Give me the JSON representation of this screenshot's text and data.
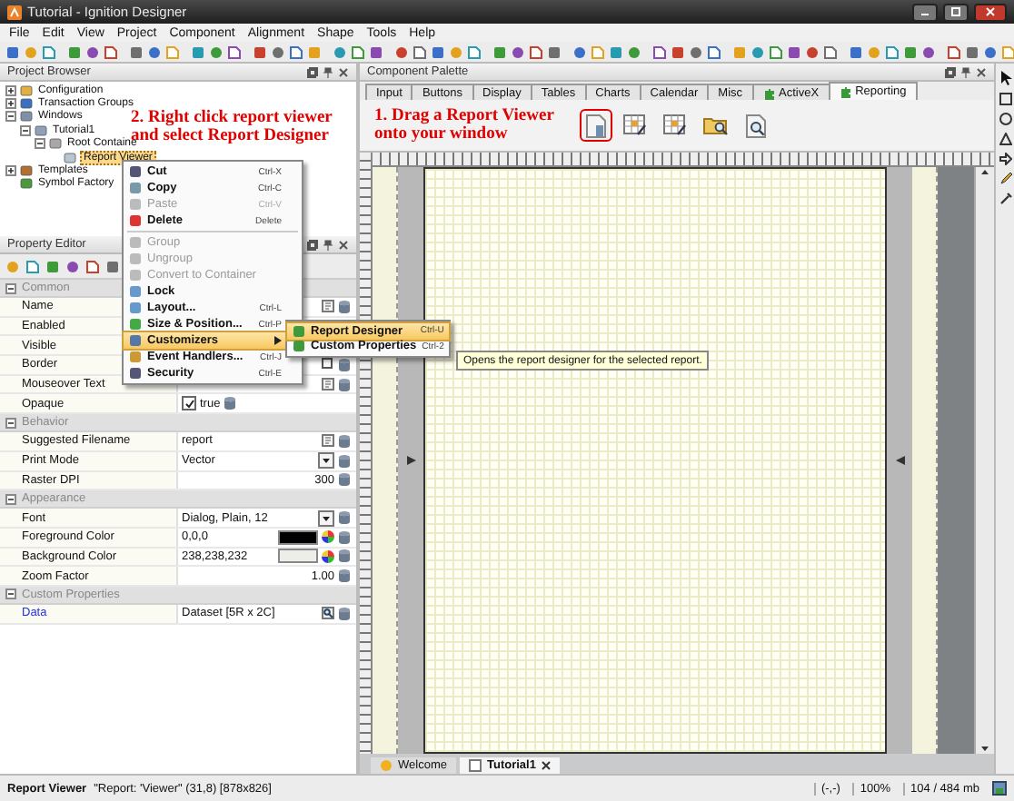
{
  "window": {
    "title": "Tutorial - Ignition Designer"
  },
  "menu": [
    "File",
    "Edit",
    "View",
    "Project",
    "Component",
    "Alignment",
    "Shape",
    "Tools",
    "Help"
  ],
  "project_browser": {
    "title": "Project Browser",
    "tree": [
      {
        "label": "Configuration",
        "kind": "config",
        "expanded": false,
        "selected": false
      },
      {
        "label": "Transaction Groups",
        "kind": "groups",
        "expanded": false,
        "selected": false
      },
      {
        "label": "Windows",
        "kind": "windows",
        "expanded": true,
        "selected": false,
        "children": [
          {
            "label": "Tutorial1",
            "kind": "window",
            "expanded": true,
            "selected": false,
            "children": [
              {
                "label": "Root Containe",
                "kind": "container",
                "expanded": true,
                "selected": false,
                "children": [
                  {
                    "label": "Report Viewer",
                    "kind": "component",
                    "selected": true
                  }
                ]
              }
            ]
          }
        ]
      },
      {
        "label": "Templates",
        "kind": "templates",
        "expanded": false,
        "selected": false
      },
      {
        "label": "Symbol Factory",
        "kind": "symbols",
        "selected": false
      }
    ]
  },
  "callouts": [
    {
      "lines": [
        "2. Right click report viewer",
        "and select Report Designer"
      ]
    },
    {
      "lines": [
        "1. Drag a Report Viewer",
        "onto your window"
      ]
    }
  ],
  "context_menu": {
    "items": [
      {
        "kind": "item",
        "label": "Cut",
        "shortcut": "Ctrl-X",
        "disabled": false,
        "selected": false,
        "submenu": false
      },
      {
        "kind": "item",
        "label": "Copy",
        "shortcut": "Ctrl-C",
        "disabled": false,
        "selected": false,
        "submenu": false
      },
      {
        "kind": "item",
        "label": "Paste",
        "shortcut": "Ctrl-V",
        "disabled": true,
        "selected": false,
        "submenu": false
      },
      {
        "kind": "item",
        "label": "Delete",
        "shortcut": "Delete",
        "disabled": false,
        "selected": false,
        "submenu": false
      },
      {
        "kind": "separator"
      },
      {
        "kind": "item",
        "label": "Group",
        "disabled": true,
        "selected": false,
        "submenu": false
      },
      {
        "kind": "item",
        "label": "Ungroup",
        "disabled": true,
        "selected": false,
        "submenu": false
      },
      {
        "kind": "item",
        "label": "Convert to Container",
        "disabled": true,
        "selected": false,
        "submenu": false
      },
      {
        "kind": "item",
        "label": "Lock",
        "disabled": false,
        "selected": false,
        "submenu": false
      },
      {
        "kind": "item",
        "label": "Layout...",
        "shortcut": "Ctrl-L",
        "disabled": false,
        "selected": false,
        "submenu": false
      },
      {
        "kind": "item",
        "label": "Size & Position...",
        "shortcut": "Ctrl-P",
        "disabled": false,
        "selected": false,
        "submenu": false
      },
      {
        "kind": "item",
        "label": "Customizers",
        "disabled": false,
        "selected": true,
        "submenu": true
      },
      {
        "kind": "item",
        "label": "Event Handlers...",
        "shortcut": "Ctrl-J",
        "disabled": false,
        "selected": false,
        "submenu": false
      },
      {
        "kind": "item",
        "label": "Security",
        "shortcut": "Ctrl-E",
        "disabled": false,
        "selected": false,
        "submenu": false
      }
    ]
  },
  "submenu": {
    "items": [
      {
        "label": "Report Designer",
        "shortcut": "Ctrl-U",
        "selected": true
      },
      {
        "label": "Custom Properties",
        "shortcut": "Ctrl-2",
        "selected": false
      }
    ]
  },
  "tooltip": {
    "text": "Opens the report designer for the selected report."
  },
  "property_editor": {
    "title": "Property Editor",
    "groups": [
      {
        "name": "Common",
        "expanded": true,
        "properties": [
          {
            "name": "Name",
            "kind": "text"
          },
          {
            "name": "Enabled",
            "kind": "plain"
          },
          {
            "name": "Visible",
            "kind": "plain"
          },
          {
            "name": "Border",
            "kind": "border"
          },
          {
            "name": "Mouseover Text",
            "kind": "text"
          },
          {
            "name": "Opaque",
            "kind": "checkbox",
            "checked": true,
            "value": "true"
          }
        ]
      },
      {
        "name": "Behavior",
        "expanded": true,
        "properties": [
          {
            "name": "Suggested Filename",
            "kind": "text",
            "value": "report"
          },
          {
            "name": "Print Mode",
            "kind": "dropdown",
            "value": "Vector"
          },
          {
            "name": "Raster DPI",
            "kind": "number",
            "value": "300"
          }
        ]
      },
      {
        "name": "Appearance",
        "expanded": true,
        "properties": [
          {
            "name": "Font",
            "kind": "dropdown",
            "value": "Dialog, Plain, 12"
          },
          {
            "name": "Foreground Color",
            "kind": "color",
            "value": "0,0,0"
          },
          {
            "name": "Background Color",
            "kind": "color",
            "value": "238,238,232"
          },
          {
            "name": "Zoom Factor",
            "kind": "number",
            "value": "1.00"
          }
        ]
      },
      {
        "name": "Custom Properties",
        "expanded": true,
        "properties": [
          {
            "name": "Data",
            "kind": "dataset",
            "value": "Dataset [5R x 2C]"
          }
        ]
      }
    ]
  },
  "component_palette": {
    "title": "Component Palette",
    "tabs": [
      {
        "label": "Input",
        "kind": "builtin",
        "selected": false
      },
      {
        "label": "Buttons",
        "kind": "builtin",
        "selected": false
      },
      {
        "label": "Display",
        "kind": "builtin",
        "selected": false
      },
      {
        "label": "Tables",
        "kind": "builtin",
        "selected": false
      },
      {
        "label": "Charts",
        "kind": "builtin",
        "selected": false
      },
      {
        "label": "Calendar",
        "kind": "builtin",
        "selected": false
      },
      {
        "label": "Misc",
        "kind": "builtin",
        "selected": false
      },
      {
        "label": "ActiveX",
        "kind": "module",
        "selected": false
      },
      {
        "label": "Reporting",
        "kind": "module",
        "selected": true
      }
    ],
    "items": [
      {
        "kind": "viewer",
        "highlighted": true
      },
      {
        "kind": "table",
        "highlighted": false
      },
      {
        "kind": "table",
        "highlighted": false
      },
      {
        "kind": "folder",
        "highlighted": false
      },
      {
        "kind": "preview",
        "highlighted": false
      }
    ]
  },
  "doc_tabs": [
    {
      "label": "Welcome",
      "kind": "welcome",
      "selected": false,
      "closable": false
    },
    {
      "label": "Tutorial1",
      "kind": "window",
      "selected": true,
      "closable": true
    }
  ],
  "status_bar": {
    "component": "Report Viewer",
    "detail": "\"Report: 'Viewer\" (31,8) [878x826]",
    "cursor": "(-,-)",
    "zoom": "100%",
    "memory": "104 / 484 mb"
  }
}
